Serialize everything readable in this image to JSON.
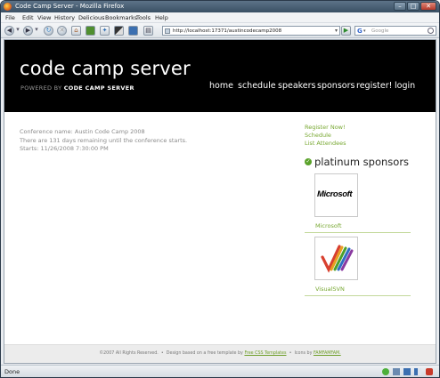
{
  "window": {
    "title": "Code Camp Server - Mozilla Firefox"
  },
  "menu": [
    "File",
    "Edit",
    "View",
    "History",
    "Delicious",
    "Bookmarks",
    "Tools",
    "Help"
  ],
  "addressbar": {
    "url": "http://localhost:17371/austincodecamp2008"
  },
  "searchbox": {
    "placeholder": "Google"
  },
  "site": {
    "title": "code camp server",
    "powered_prefix": "POWERED BY",
    "powered_name": "CODE CAMP SERVER"
  },
  "nav": [
    "home",
    "schedule",
    "speakers",
    "sponsors",
    "register!",
    "login"
  ],
  "conference": {
    "name_line": "Conference name: Austin Code Camp 2008",
    "remaining_line": "There are 131 days remaining until the conference starts.",
    "starts_line": "Starts: 11/26/2008 7:30:00 PM"
  },
  "sidebar": {
    "links": [
      "Register Now!",
      "Schedule",
      "List Attendees"
    ],
    "platinum_heading": "platinum sponsors",
    "sponsors": [
      {
        "name": "Microsoft",
        "logo_text": "Microsoft"
      },
      {
        "name": "VisualSVN"
      }
    ]
  },
  "footer": {
    "copyright": "©2007 All Rights Reserved.",
    "sep": "•",
    "design_text": "Design based on a free template by",
    "design_link": "Free CSS Templates",
    "icons_text": "Icons by",
    "icons_link": "FAMFAMFAM."
  },
  "statusbar": {
    "status": "Done"
  },
  "colors": {
    "accent_green": "#78a832",
    "header_bg": "#000000"
  }
}
